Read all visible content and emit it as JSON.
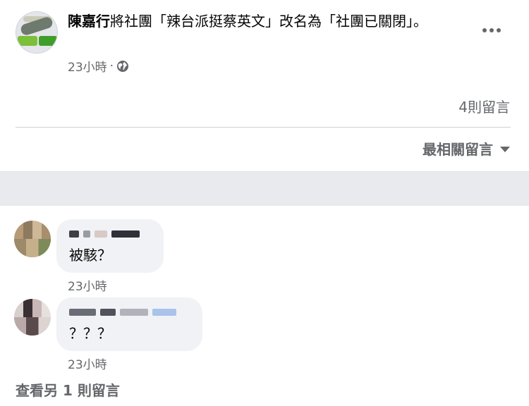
{
  "post": {
    "author": "陳嘉行",
    "text": "將社團「辣台派挺蔡英文」改名為「社團已關閉」。",
    "timestamp": "23小時",
    "separator": "·",
    "privacy_icon": "globe-icon",
    "more_icon": "more-options-icon"
  },
  "comments_bar": {
    "count_label": "4則留言",
    "sort_label": "最相關留言",
    "sort_icon": "caret-down-icon"
  },
  "comments": [
    {
      "text": "被駭？",
      "timestamp": "23小時"
    },
    {
      "text": "？？？",
      "timestamp": "23小時"
    }
  ],
  "view_more_label": "查看另 1 則留言",
  "colors": {
    "text_primary": "#050505",
    "text_secondary": "#65676b",
    "bubble_bg": "#f0f2f5",
    "divider": "#ced0d4",
    "section_gap": "#e8eaed"
  }
}
